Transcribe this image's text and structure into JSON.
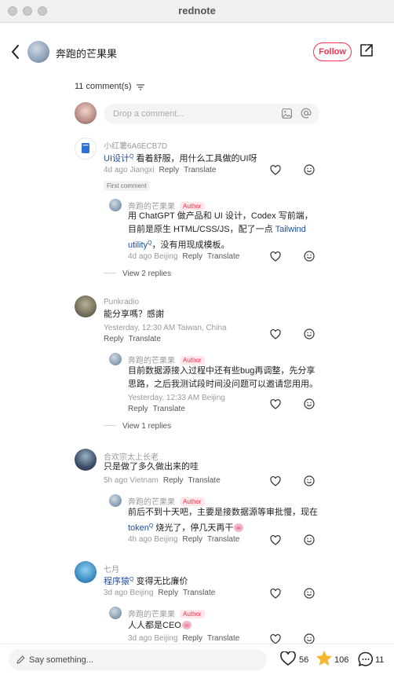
{
  "window": {
    "title": "rednote"
  },
  "header": {
    "author_name": "奔跑的芒果果",
    "follow_label": "Follow"
  },
  "comments_header": {
    "count_label": "11 comment(s)",
    "input_placeholder": "Drop a comment..."
  },
  "labels": {
    "reply": "Reply",
    "translate": "Translate",
    "author_tag": "Author",
    "first_comment": "First comment"
  },
  "comments": [
    {
      "user": "小红薯6A6ECB7D",
      "link": "UI设计",
      "text_after_link": " 看着舒服，用什么工具做的UI呀",
      "meta": "4d ago Jiangxi",
      "reply": {
        "user": "奔跑的芒果果",
        "line1": "用 ChatGPT 做产品和 UI 设计，Codex 写前端，",
        "line2_pre": "目前是原生 HTML/CSS/JS，配了一点 ",
        "line2_link": "Tailwind",
        "line3_link": "utility",
        "line3_post": "，没有用现成模板。",
        "meta": "4d ago Beijing"
      },
      "view_replies": "View 2 replies"
    },
    {
      "user": "Punkradio",
      "text": "能分享嗎？感謝",
      "meta": "Yesterday, 12:30 AM Taiwan, China",
      "reply": {
        "user": "奔跑的芒果果",
        "line1": "目前数据源接入过程中还有些bug再调整，先分享",
        "line2": "思路，之后我测试段时间没问题可以邀请您用用。",
        "meta": "Yesterday, 12:33 AM Beijing"
      },
      "view_replies": "View 1 replies"
    },
    {
      "user": "合欢宗太上长老",
      "text": "只是做了多久做出来的哇",
      "meta": "5h ago Vietnam",
      "reply": {
        "user": "奔跑的芒果果",
        "line1": "前后不到十天吧，主要是接数据源等审批慢，现在",
        "line2_link": "token",
        "line2_post": " 烧光了，停几天再干",
        "meta": "4h ago Beijing"
      }
    },
    {
      "user": "七月",
      "link": "程序猿",
      "text_after_link": " 变得无比廉价",
      "meta": "3d ago Beijing",
      "reply": {
        "user": "奔跑的芒果果",
        "line1": "人人都是CEO",
        "meta": "3d ago Beijing"
      }
    }
  ],
  "bottom": {
    "placeholder": "Say something...",
    "likes": "56",
    "stars": "106",
    "comments": "11"
  },
  "colors": {
    "accent": "#ff2e4d",
    "link": "#1f4fa0"
  }
}
